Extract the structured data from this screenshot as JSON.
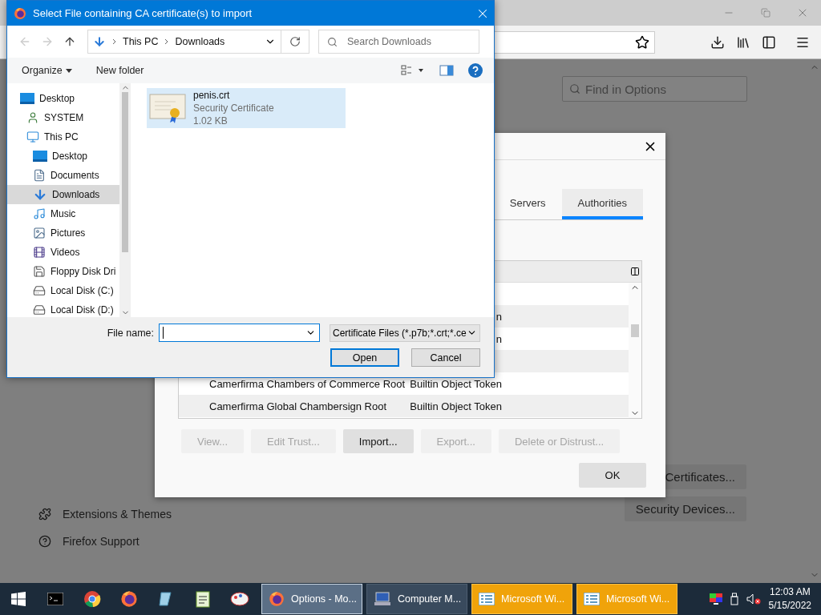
{
  "browser": {
    "find_placeholder": "Find in Options",
    "sidebar_items": [
      {
        "label": "Extensions & Themes",
        "kind": "extensions"
      },
      {
        "label": "Firefox Support",
        "kind": "support"
      }
    ],
    "buttons": [
      "Certificates...",
      "Security Devices..."
    ]
  },
  "certificate_manager": {
    "tabs": [
      {
        "label": "Servers",
        "selected": false
      },
      {
        "label": "Authorities",
        "selected": true
      }
    ],
    "rows": [
      {
        "shaded": true,
        "column_2": "n"
      },
      {
        "shaded": false,
        "column_2": "n"
      },
      {
        "shaded": true
      },
      {
        "shaded": false,
        "column_1": "Camerfirma Chambers of Commerce Root",
        "column_2": "Builtin Object Token"
      },
      {
        "shaded": true,
        "column_1": "Camerfirma Global Chambersign Root",
        "column_2": "Builtin Object Token"
      }
    ],
    "buttons": [
      {
        "label": "View...",
        "disabled": true
      },
      {
        "label": "Edit Trust...",
        "disabled": true
      },
      {
        "label": "Import...",
        "disabled": false
      },
      {
        "label": "Export...",
        "disabled": true
      },
      {
        "label": "Delete or Distrust...",
        "disabled": true
      }
    ],
    "ok_button": "OK"
  },
  "file_dialog": {
    "title": "Select File containing CA certificate(s) to import",
    "breadcrumb": [
      "This PC",
      "Downloads"
    ],
    "search_placeholder": "Search Downloads",
    "commands": [
      "Organize",
      "New folder"
    ],
    "tree": [
      {
        "label": "Desktop",
        "kind": "desktop",
        "selected": false,
        "children": [
          {
            "label": "SYSTEM",
            "kind": "user",
            "selected": false
          },
          {
            "label": "This PC",
            "kind": "pc",
            "selected": false,
            "children": [
              {
                "label": "Desktop",
                "kind": "desktop",
                "selected": false
              },
              {
                "label": "Documents",
                "kind": "documents",
                "selected": false
              },
              {
                "label": "Downloads",
                "kind": "downloads",
                "selected": true
              },
              {
                "label": "Music",
                "kind": "music",
                "selected": false
              },
              {
                "label": "Pictures",
                "kind": "pictures",
                "selected": false
              },
              {
                "label": "Videos",
                "kind": "videos",
                "selected": false
              },
              {
                "label": "Floppy Disk Dri",
                "kind": "floppy",
                "selected": false
              },
              {
                "label": "Local Disk (C:)",
                "kind": "disk",
                "selected": false
              },
              {
                "label": "Local Disk (D:)",
                "kind": "disk",
                "selected": false
              }
            ]
          }
        ]
      }
    ],
    "files": [
      {
        "name": "penis.crt",
        "type": "Security Certificate",
        "size": "1.02 KB",
        "selected": true
      }
    ],
    "file_name_label": "File name:",
    "filter": "Certificate Files (*.p7b;*.crt;*.ce",
    "buttons": [
      "Open",
      "Cancel"
    ]
  },
  "taskbar": {
    "pinned": [
      {
        "kind": "terminal"
      },
      {
        "kind": "chrome"
      },
      {
        "kind": "firefox"
      },
      {
        "kind": "glass"
      },
      {
        "kind": "notepad"
      },
      {
        "kind": "paint"
      }
    ],
    "tasks": [
      {
        "label": "Options - Mo...",
        "kind": "firefox",
        "selected": true,
        "attention": false
      },
      {
        "label": "Computer M...",
        "kind": "computer",
        "selected": false,
        "attention": false
      },
      {
        "label": "Microsoft Wi...",
        "kind": "form",
        "selected": false,
        "attention": true
      },
      {
        "label": "Microsoft Wi...",
        "kind": "form",
        "selected": false,
        "attention": true
      }
    ],
    "time": "12:03 AM",
    "date": "5/15/2022"
  }
}
